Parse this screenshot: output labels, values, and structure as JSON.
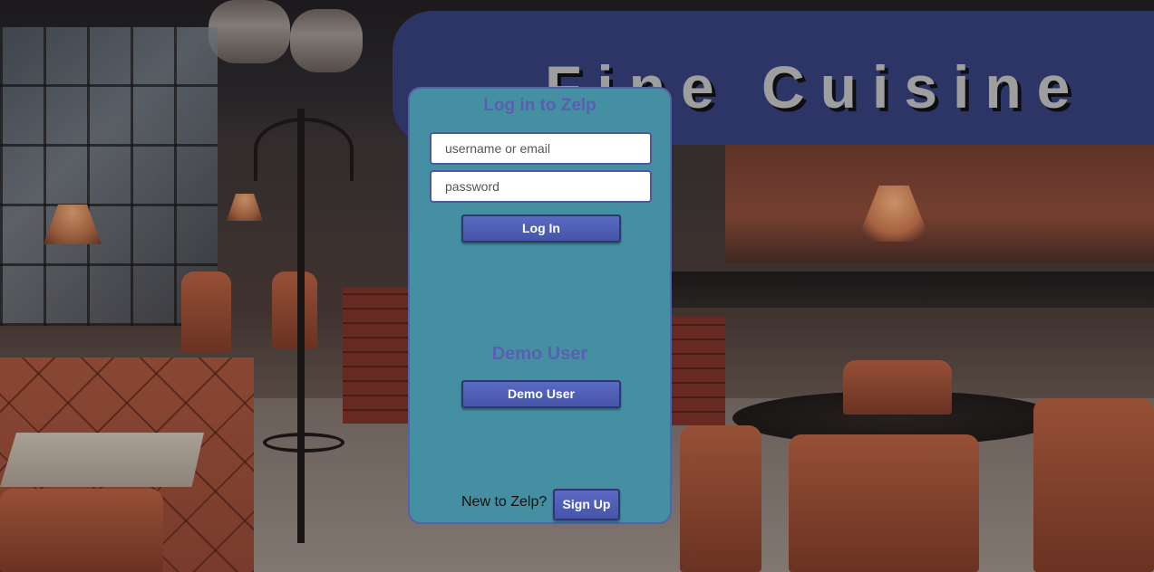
{
  "header": {
    "title": "Fine Cuisine"
  },
  "login_panel": {
    "title": "Log in to Zelp",
    "username_placeholder": "username or email",
    "password_placeholder": "password",
    "login_button": "Log In",
    "demo_heading": "Demo User",
    "demo_button": "Demo User",
    "signup_prompt": "New to Zelp?",
    "signup_button": "Sign Up"
  },
  "colors": {
    "banner": "#2c3566",
    "panel": "#4490a2",
    "button": "#4655a8",
    "heading_text": "#5a5fb0",
    "title_text": "#9e9e9e"
  }
}
